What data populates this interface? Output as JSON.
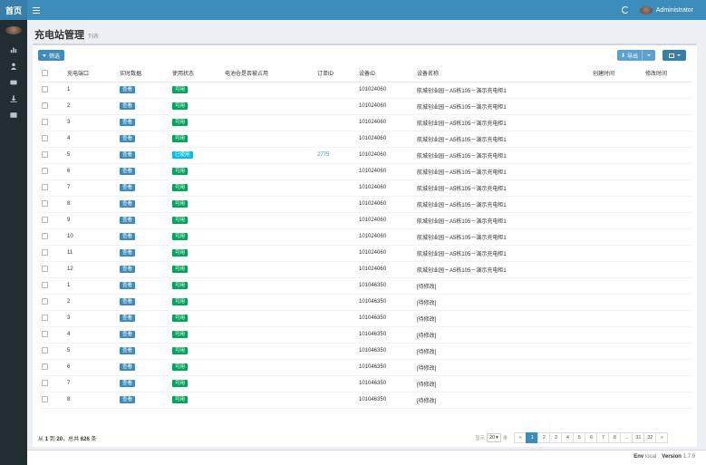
{
  "header": {
    "logo": "首页",
    "user_name": "Administrator"
  },
  "sidebar": {
    "items": [
      {
        "icon": "bar-chart-icon"
      },
      {
        "icon": "user-icon"
      },
      {
        "icon": "credit-card-icon"
      },
      {
        "icon": "download-icon"
      },
      {
        "icon": "list-icon"
      }
    ]
  },
  "page": {
    "title": "充电站管理",
    "subtitle": "列表"
  },
  "toolbar": {
    "filter_label": "筛选",
    "export_label": "导出"
  },
  "table": {
    "columns": [
      "充电端口",
      "实时数据",
      "使用状态",
      "电池仓是否被占用",
      "订单ID",
      "设备ID",
      "设备名称",
      "创建时间",
      "修改时间"
    ],
    "rows": [
      {
        "port": "1",
        "view": "查看",
        "status": "可用",
        "status_type": "ok",
        "occupied": "",
        "order": "",
        "device_id": "101024060",
        "device_name": "航城创业园－A5栋105－演示充电柜1",
        "created": "",
        "modified": ""
      },
      {
        "port": "2",
        "view": "查看",
        "status": "可用",
        "status_type": "ok",
        "occupied": "",
        "order": "",
        "device_id": "101024060",
        "device_name": "航城创业园－A5栋105－演示充电柜1",
        "created": "",
        "modified": ""
      },
      {
        "port": "3",
        "view": "查看",
        "status": "可用",
        "status_type": "ok",
        "occupied": "",
        "order": "",
        "device_id": "101024060",
        "device_name": "航城创业园－A5栋105－演示充电柜1",
        "created": "",
        "modified": ""
      },
      {
        "port": "4",
        "view": "查看",
        "status": "可用",
        "status_type": "ok",
        "occupied": "",
        "order": "",
        "device_id": "101024060",
        "device_name": "航城创业园－A5栋105－演示充电柜1",
        "created": "",
        "modified": ""
      },
      {
        "port": "5",
        "view": "查看",
        "status": "已使用",
        "status_type": "used",
        "occupied": "",
        "order": "2775",
        "device_id": "101024060",
        "device_name": "航城创业园－A5栋105－演示充电柜1",
        "created": "",
        "modified": ""
      },
      {
        "port": "6",
        "view": "查看",
        "status": "可用",
        "status_type": "ok",
        "occupied": "",
        "order": "",
        "device_id": "101024060",
        "device_name": "航城创业园－A5栋105－演示充电柜1",
        "created": "",
        "modified": ""
      },
      {
        "port": "7",
        "view": "查看",
        "status": "可用",
        "status_type": "ok",
        "occupied": "",
        "order": "",
        "device_id": "101024060",
        "device_name": "航城创业园－A5栋105－演示充电柜1",
        "created": "",
        "modified": ""
      },
      {
        "port": "8",
        "view": "查看",
        "status": "可用",
        "status_type": "ok",
        "occupied": "",
        "order": "",
        "device_id": "101024060",
        "device_name": "航城创业园－A5栋105－演示充电柜1",
        "created": "",
        "modified": ""
      },
      {
        "port": "9",
        "view": "查看",
        "status": "可用",
        "status_type": "ok",
        "occupied": "",
        "order": "",
        "device_id": "101024060",
        "device_name": "航城创业园－A5栋105－演示充电柜1",
        "created": "",
        "modified": ""
      },
      {
        "port": "10",
        "view": "查看",
        "status": "可用",
        "status_type": "ok",
        "occupied": "",
        "order": "",
        "device_id": "101024060",
        "device_name": "航城创业园－A5栋105－演示充电柜1",
        "created": "",
        "modified": ""
      },
      {
        "port": "11",
        "view": "查看",
        "status": "可用",
        "status_type": "ok",
        "occupied": "",
        "order": "",
        "device_id": "101024060",
        "device_name": "航城创业园－A5栋105－演示充电柜1",
        "created": "",
        "modified": ""
      },
      {
        "port": "12",
        "view": "查看",
        "status": "可用",
        "status_type": "ok",
        "occupied": "",
        "order": "",
        "device_id": "101024060",
        "device_name": "航城创业园－A5栋105－演示充电柜1",
        "created": "",
        "modified": ""
      },
      {
        "port": "1",
        "view": "查看",
        "status": "可用",
        "status_type": "ok",
        "occupied": "",
        "order": "",
        "device_id": "101046350",
        "device_name": "[待修改]",
        "created": "",
        "modified": ""
      },
      {
        "port": "2",
        "view": "查看",
        "status": "可用",
        "status_type": "ok",
        "occupied": "",
        "order": "",
        "device_id": "101046350",
        "device_name": "[待修改]",
        "created": "",
        "modified": ""
      },
      {
        "port": "3",
        "view": "查看",
        "status": "可用",
        "status_type": "ok",
        "occupied": "",
        "order": "",
        "device_id": "101046350",
        "device_name": "[待修改]",
        "created": "",
        "modified": ""
      },
      {
        "port": "4",
        "view": "查看",
        "status": "可用",
        "status_type": "ok",
        "occupied": "",
        "order": "",
        "device_id": "101046350",
        "device_name": "[待修改]",
        "created": "",
        "modified": ""
      },
      {
        "port": "5",
        "view": "查看",
        "status": "可用",
        "status_type": "ok",
        "occupied": "",
        "order": "",
        "device_id": "101046350",
        "device_name": "[待修改]",
        "created": "",
        "modified": ""
      },
      {
        "port": "6",
        "view": "查看",
        "status": "可用",
        "status_type": "ok",
        "occupied": "",
        "order": "",
        "device_id": "101046350",
        "device_name": "[待修改]",
        "created": "",
        "modified": ""
      },
      {
        "port": "7",
        "view": "查看",
        "status": "可用",
        "status_type": "ok",
        "occupied": "",
        "order": "",
        "device_id": "101046350",
        "device_name": "[待修改]",
        "created": "",
        "modified": ""
      },
      {
        "port": "8",
        "view": "查看",
        "status": "可用",
        "status_type": "ok",
        "occupied": "",
        "order": "",
        "device_id": "101046350",
        "device_name": "[待修改]",
        "created": "",
        "modified": ""
      }
    ]
  },
  "footer": {
    "info_prefix": "从",
    "info_from": "1",
    "info_mid": "到",
    "info_to": "20",
    "info_mid2": "，总共",
    "info_total": "626",
    "info_suffix": "条"
  },
  "pagination": {
    "show_label": "显示",
    "per_page": "20",
    "per_unit": "条",
    "prev": "«",
    "next": "»",
    "pages": [
      "1",
      "2",
      "3",
      "4",
      "5",
      "6",
      "7",
      "8",
      "...",
      "31",
      "32"
    ],
    "active": "1"
  },
  "env": {
    "env_label": "Env",
    "env_value": "local",
    "version_label": "Version",
    "version_value": "1.7.9"
  },
  "colors": {
    "header": "#3c8dbc",
    "sidebar": "#222d32",
    "label_ok": "#00a65a",
    "label_used": "#00c0ef",
    "label_view": "#3c8dbc"
  }
}
